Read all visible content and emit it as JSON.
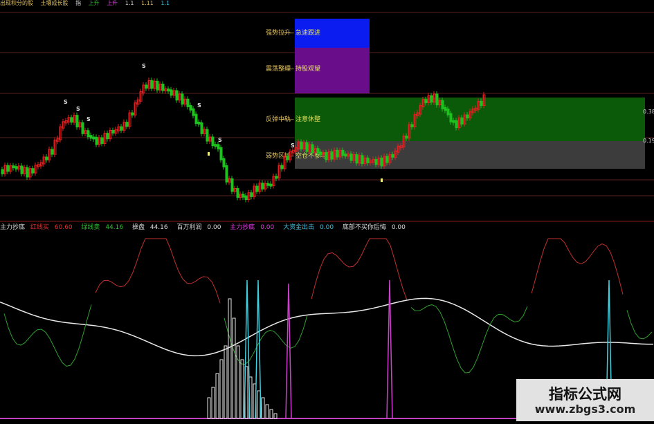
{
  "topbar": {
    "segments": [
      "出现积分的股",
      "土壤成长股",
      "指",
      "上升",
      "上升",
      "1.1",
      "1.11",
      "1.1"
    ]
  },
  "main_panel": {
    "zones": [
      {
        "label": "强势拉升",
        "action": "急速跟进",
        "color": "#0b1cf0"
      },
      {
        "label": "震荡整理",
        "action": "持股观望",
        "color": "#6a0d8a"
      },
      {
        "label": "反弹中轨",
        "action": "注意休整",
        "color": "#0a5a0a"
      },
      {
        "label": "弱势区域",
        "action": "空仓不参与",
        "color": "#3c3c3c"
      }
    ],
    "right_scale": [
      "0.38",
      "0.19"
    ],
    "signal_marker": "S"
  },
  "indicator_panel": {
    "name": "主力抄底",
    "fields": [
      {
        "label": "红线买",
        "value": "60.60",
        "color": "#e03030"
      },
      {
        "label": "绿线卖",
        "value": "44.16",
        "color": "#2ec02e"
      },
      {
        "label": "操盘",
        "value": "44.16",
        "color": "#dddddd"
      },
      {
        "label": "百万利润",
        "value": "0.00",
        "color": "#dddddd"
      },
      {
        "label": "主力抄底",
        "value": "0.00",
        "color": "#e040e0"
      },
      {
        "label": "大资金出击",
        "value": "0.00",
        "color": "#40c0e0"
      },
      {
        "label": "底部不买你后悔",
        "value": "0.00",
        "color": "#dddddd"
      }
    ]
  },
  "watermark": {
    "title": "指标公式网",
    "url": "www.zbgs3.com"
  },
  "colors": {
    "background": "#000000",
    "candle_up": "#e02020",
    "candle_down": "#20c020",
    "red_line": "#c03030",
    "green_line": "#30a030",
    "white_line": "#e8e8e8",
    "magenta": "#d040d0",
    "cyan": "#40d0e0",
    "grid": "#5a2020"
  }
}
